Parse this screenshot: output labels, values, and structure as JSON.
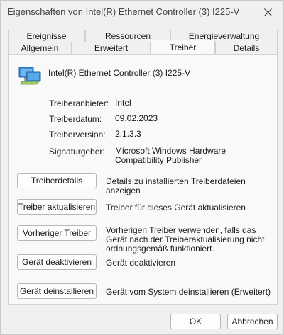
{
  "window": {
    "title": "Eigenschaften von Intel(R) Ethernet Controller (3) I225-V",
    "close_icon": "close-icon"
  },
  "tabs": {
    "back_row": [
      "Ereignisse",
      "Ressourcen",
      "Energieverwaltung"
    ],
    "front_row": [
      "Allgemein",
      "Erweitert",
      "Treiber",
      "Details"
    ],
    "active": "Treiber"
  },
  "device": {
    "icon": "network-adapter-icon",
    "name": "Intel(R) Ethernet Controller (3) I225-V"
  },
  "properties": [
    {
      "label": "Treiberanbieter:",
      "value": "Intel"
    },
    {
      "label": "Treiberdatum:",
      "value": "09.02.2023"
    },
    {
      "label": "Treiberversion:",
      "value": "2.1.3.3"
    },
    {
      "label": "Signaturgeber:",
      "value": "Microsoft Windows Hardware Compatibility Publisher"
    }
  ],
  "actions": [
    {
      "button": "Treiberdetails",
      "description": "Details zu installierten Treiberdateien anzeigen"
    },
    {
      "button": "Treiber aktualisieren",
      "description": "Treiber für dieses Gerät aktualisieren"
    },
    {
      "button": "Vorheriger Treiber",
      "description": "Vorherigen Treiber verwenden, falls das Gerät nach der Treiberaktualisierung nicht ordnungsgemäß funktioniert."
    },
    {
      "button": "Gerät deaktivieren",
      "description": "Gerät deaktivieren"
    },
    {
      "button": "Gerät deinstallieren",
      "description": "Gerät vom System deinstallieren (Erweitert)"
    }
  ],
  "footer": {
    "ok": "OK",
    "cancel": "Abbrechen"
  }
}
